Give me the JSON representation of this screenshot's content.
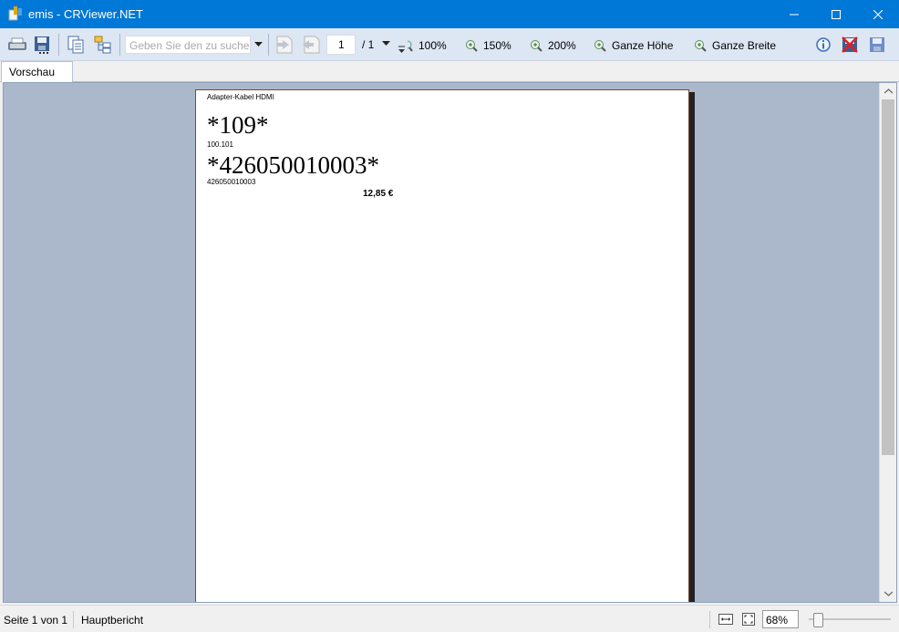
{
  "window": {
    "title": "emis - CRViewer.NET",
    "minimize_glyph": "—",
    "maximize_glyph": "☐",
    "close_glyph": "✕"
  },
  "toolbar": {
    "search_placeholder": "Geben Sie den zu suchen",
    "page_number": "1",
    "page_total": "/ 1",
    "zoom_100": "100%",
    "zoom_150": "150%",
    "zoom_200": "200%",
    "whole_height": "Ganze Höhe",
    "whole_width": "Ganze Breite"
  },
  "tabs": [
    {
      "label": "Vorschau"
    }
  ],
  "report": {
    "product_name": "Adapter-Kabel HDMI",
    "barcode1": "*109*",
    "code1": "100.101",
    "barcode2": "*426050010003*",
    "code2": "426050010003",
    "price": "12,85 €"
  },
  "status": {
    "page_info": "Seite 1 von 1",
    "report_name": "Hauptbericht",
    "zoom_value": "68%"
  },
  "colors": {
    "titlebar": "#0078d7",
    "toolbar": "#dde6f3",
    "viewer_bg": "#abb8cc"
  }
}
